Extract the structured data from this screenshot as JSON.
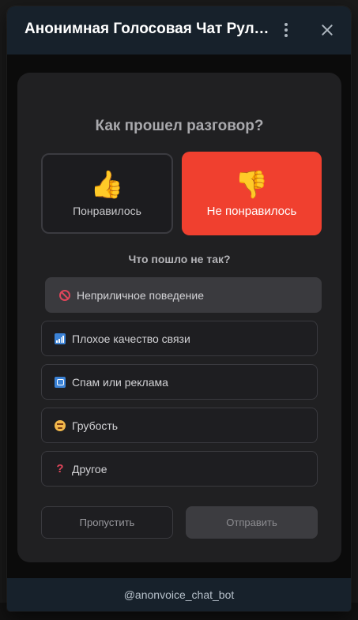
{
  "window": {
    "title": "Анонимная Голосовая Чат Руле...",
    "footer": "@anonvoice_chat_bot"
  },
  "feedback": {
    "title": "Как прошел разговор?",
    "like": {
      "icon": "👍",
      "label": "Понравилось"
    },
    "dislike": {
      "icon": "👎",
      "label": "Не понравилось"
    },
    "reasons_title": "Что пошло не так?",
    "reasons": [
      {
        "icon": "no-entry-icon",
        "label": "Неприличное поведение",
        "selected": true
      },
      {
        "icon": "signal-bars-icon",
        "label": "Плохое качество связи",
        "selected": false
      },
      {
        "icon": "repeat-icon",
        "label": "Спам или реклама",
        "selected": false
      },
      {
        "icon": "angry-face-icon",
        "label": "Грубость",
        "selected": false
      },
      {
        "icon": "question-mark-icon",
        "label": "Другое",
        "selected": false
      }
    ],
    "skip_label": "Пропустить",
    "send_label": "Отправить"
  },
  "colors": {
    "accent_dislike": "#f0402f",
    "header": "#17212b",
    "card": "#202022"
  }
}
